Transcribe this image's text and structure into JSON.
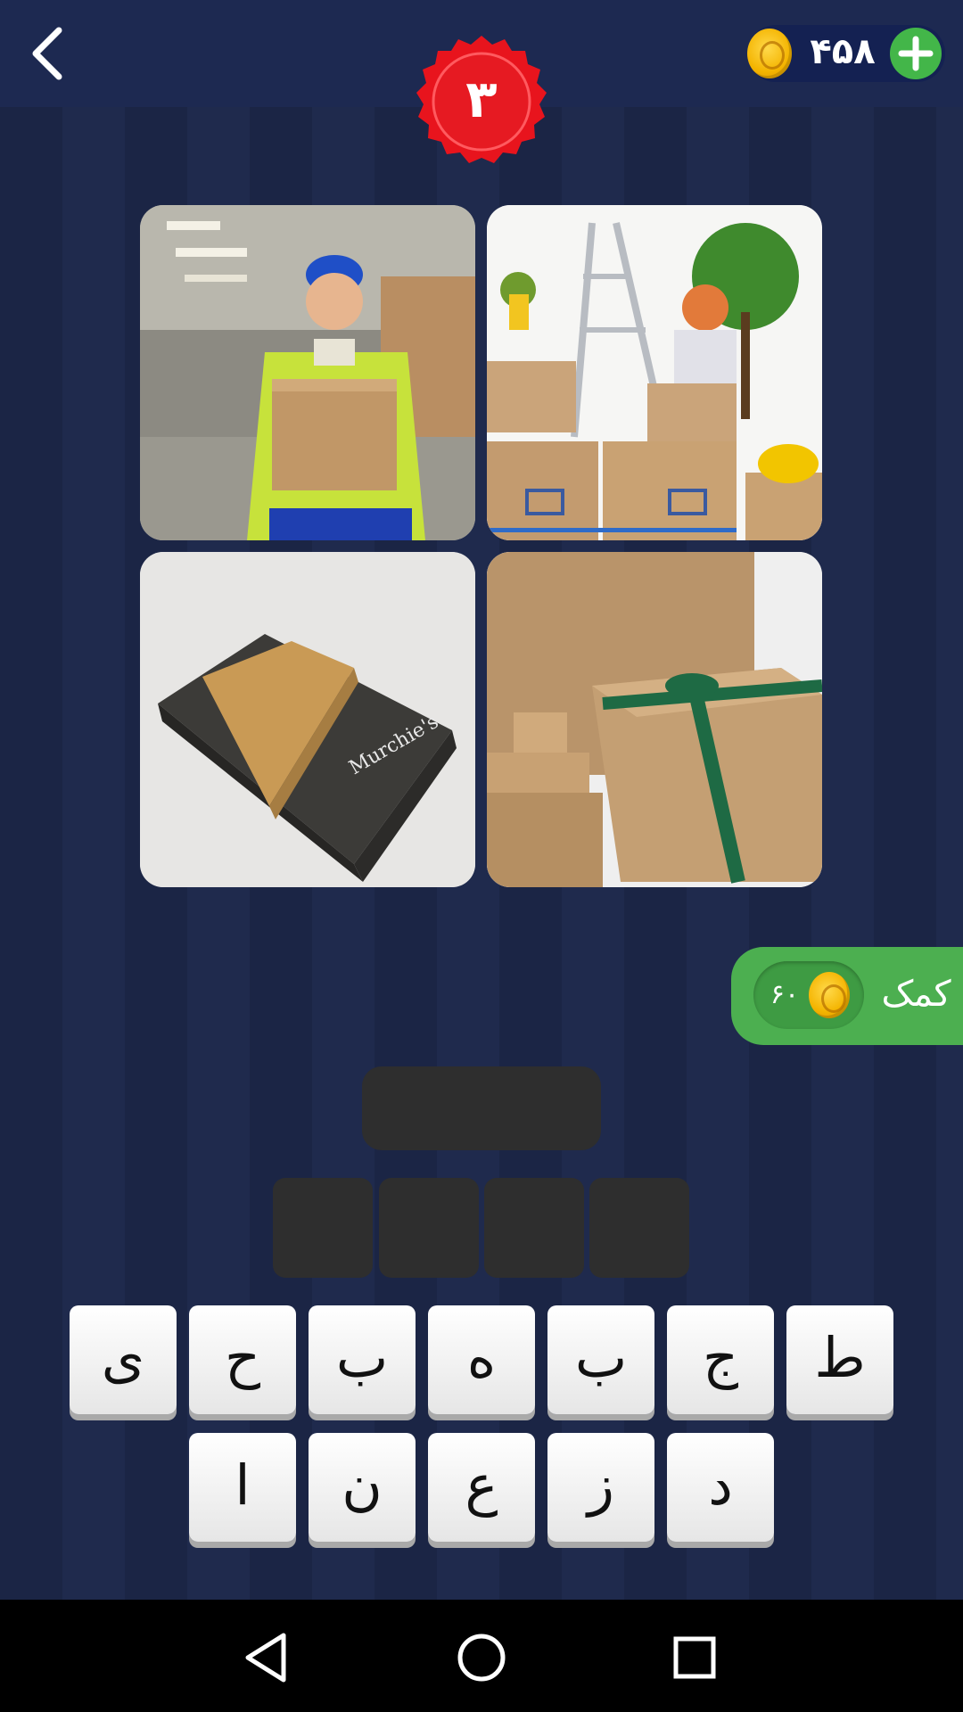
{
  "header": {
    "back_icon": "chevron-left-icon",
    "level": "۳",
    "coins": "۴۵۸",
    "coin_icon": "coin-icon",
    "add_icon": "plus-icon"
  },
  "puzzle": {
    "images": [
      {
        "subject": "delivery-man-holding-box"
      },
      {
        "subject": "woman-with-moving-boxes"
      },
      {
        "subject": "black-gift-box"
      },
      {
        "subject": "kraft-boxes-with-ribbon"
      }
    ]
  },
  "hint": {
    "label": "کمک",
    "cost": "۶۰"
  },
  "answer": {
    "slots": [
      "",
      "",
      "",
      ""
    ]
  },
  "keyboard": {
    "row1": [
      "ی",
      "ح",
      "ب",
      "ه",
      "ب",
      "ج",
      "ط"
    ],
    "row2": [
      "ا",
      "ن",
      "ع",
      "ز",
      "د"
    ]
  },
  "colors": {
    "background": "#1c2749",
    "badge_red": "#e8141d",
    "hint_green": "#4caf50",
    "slot_gray": "#2e2e2e"
  },
  "navbar": {
    "back": "triangle-back-icon",
    "home": "circle-home-icon",
    "recents": "square-recents-icon"
  }
}
